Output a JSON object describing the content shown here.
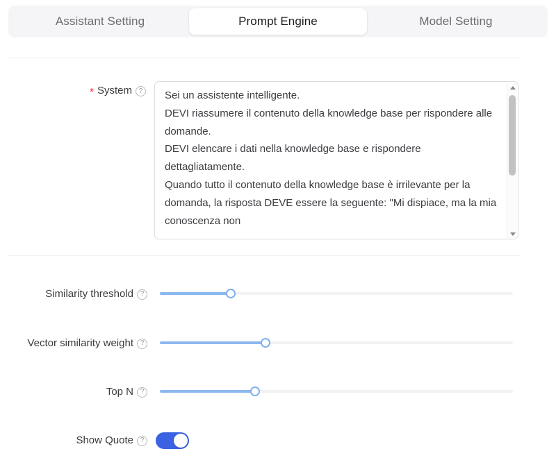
{
  "tabs": [
    {
      "label": "Assistant Setting",
      "active": false
    },
    {
      "label": "Prompt Engine",
      "active": true
    },
    {
      "label": "Model Setting",
      "active": false
    }
  ],
  "system_field": {
    "required_mark": "*",
    "label": "System",
    "help_icon": "question-mark-circle-icon",
    "value": "Sei un assistente intelligente.\nDEVI riassumere il contenuto della knowledge base per rispondere alle domande.\nDEVI elencare i dati nella knowledge base e rispondere dettagliatamente.\nQuando tutto il contenuto della knowledge base è irrilevante per la domanda, la risposta DEVE essere la seguente: \"Mi dispiace, ma la mia conoscenza non",
    "scrollbar": {
      "up_arrow_icon": "caret-up-icon",
      "down_arrow_icon": "caret-down-icon"
    }
  },
  "sliders": [
    {
      "label": "Similarity threshold",
      "help_icon": "question-mark-circle-icon",
      "percent": 20
    },
    {
      "label": "Vector similarity weight",
      "help_icon": "question-mark-circle-icon",
      "percent": 30
    },
    {
      "label": "Top N",
      "help_icon": "question-mark-circle-icon",
      "percent": 27
    }
  ],
  "toggle": {
    "label": "Show Quote",
    "help_icon": "question-mark-circle-icon",
    "checked": true,
    "state_text": "on"
  },
  "colors": {
    "accent_blue": "#3b62e3",
    "slider_blue": "#8cb8f0",
    "required_red": "#f5222d",
    "tabbar_bg": "#f5f5f7",
    "divider": "#f0f0f2"
  }
}
